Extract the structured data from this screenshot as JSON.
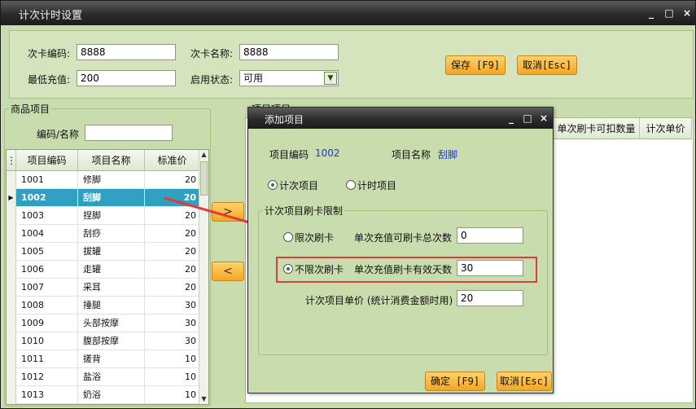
{
  "window": {
    "title": "计次计时设置",
    "controls": [
      "_",
      "□",
      "×"
    ]
  },
  "top": {
    "card_code_label": "次卡编码:",
    "card_code": "8888",
    "card_name_label": "次卡名称:",
    "card_name": "8888",
    "min_recharge_label": "最低充值:",
    "min_recharge": "200",
    "status_label": "启用状态:",
    "status": "可用",
    "save": "保存 [F9]",
    "cancel": "取消[Esc]"
  },
  "products": {
    "group_title": "商品项目",
    "search_label": "编码/名称",
    "search_value": "",
    "headers": [
      "项目编码",
      "项目名称",
      "标准价"
    ],
    "rows": [
      {
        "code": "1001",
        "name": "修脚",
        "price": "20"
      },
      {
        "code": "1002",
        "name": "刮脚",
        "price": "20"
      },
      {
        "code": "1003",
        "name": "捏脚",
        "price": "20"
      },
      {
        "code": "1004",
        "name": "刮痧",
        "price": "20"
      },
      {
        "code": "1005",
        "name": "拔罐",
        "price": "20"
      },
      {
        "code": "1006",
        "name": "走罐",
        "price": "20"
      },
      {
        "code": "1007",
        "name": "采耳",
        "price": "20"
      },
      {
        "code": "1008",
        "name": "捶腿",
        "price": "30"
      },
      {
        "code": "1009",
        "name": "头部按摩",
        "price": "30"
      },
      {
        "code": "1010",
        "name": "腹部按摩",
        "price": "30"
      },
      {
        "code": "1011",
        "name": "搓背",
        "price": "10"
      },
      {
        "code": "1012",
        "name": "盐浴",
        "price": "10"
      },
      {
        "code": "1013",
        "name": "奶浴",
        "price": "10"
      }
    ],
    "selected_index": 1
  },
  "move": {
    "add": ">",
    "remove": "<"
  },
  "items": {
    "group_title": "项目项目",
    "headers": [
      "单次刷卡可扣数量",
      "计次单价"
    ]
  },
  "dialog": {
    "title": "添加项目",
    "controls": [
      "_",
      "□",
      "×"
    ],
    "code_label": "项目编码",
    "code": "1002",
    "name_label": "项目名称",
    "name": "刮脚",
    "type_count": "计次项目",
    "type_time": "计时项目",
    "limit_group": "计次项目刷卡限制",
    "limited_label": "限次刷卡",
    "limited_total_label": "单次充值可刷卡总次数",
    "limited_total": "0",
    "unlimited_label": "不限次刷卡",
    "unlimited_days_label": "单次充值刷卡有效天数",
    "unlimited_days": "30",
    "unit_price_label": "计次项目单价 (统计消费金额时用)",
    "unit_price": "20",
    "ok": "确定 [F9]",
    "cancel": "取消[Esc]"
  },
  "colors": {
    "panel": "#c9dcae",
    "accent_orange": "#f5a623",
    "selected_row": "#2f9fc2",
    "highlight": "#e03a3a"
  }
}
